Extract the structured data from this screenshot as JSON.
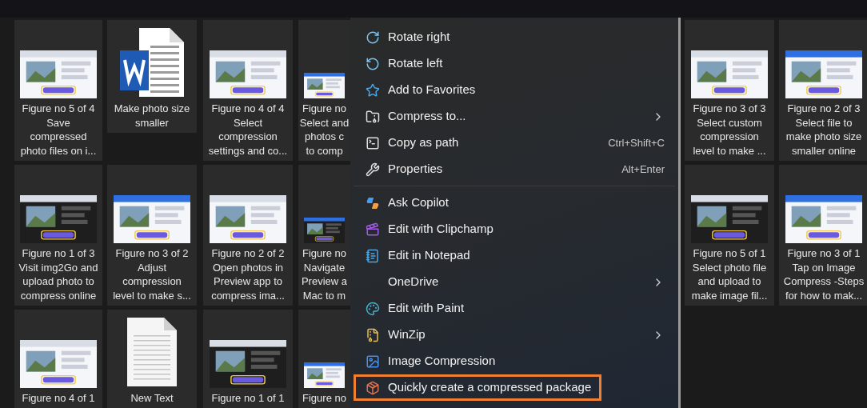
{
  "left_tiles": [
    {
      "kind": "picture",
      "caption": [
        "Figure no 5 of 4",
        "Save",
        "compressed",
        "photo files on i..."
      ]
    },
    {
      "kind": "word",
      "caption": [
        "Make photo size",
        "smaller"
      ]
    },
    {
      "kind": "picture",
      "caption": [
        "Figure no 4 of 4",
        "Select",
        "compression",
        "settings and co..."
      ]
    },
    {
      "kind": "picture",
      "caption": [
        "Figure no",
        "Select and",
        "photos c",
        "to comp"
      ]
    },
    {
      "kind": "picture",
      "caption": [
        "Figure no 1 of 3",
        "Visit img2Go and",
        "upload photo to",
        "compress online"
      ]
    },
    {
      "kind": "picture",
      "caption": [
        "Figure no 3 of 2",
        "Adjust",
        "compression",
        "level to make s..."
      ]
    },
    {
      "kind": "picture",
      "caption": [
        "Figure no 2 of 2",
        "Open photos in",
        "Preview app to",
        "compress ima..."
      ]
    },
    {
      "kind": "picture",
      "caption": [
        "Figure no",
        "Navigate",
        "Preview a",
        "Mac to m"
      ]
    },
    {
      "kind": "picture",
      "caption": [
        "Figure no 4 of 1"
      ]
    },
    {
      "kind": "text",
      "caption": [
        "New Text"
      ]
    },
    {
      "kind": "picture",
      "caption": [
        "Figure no 1 of 1"
      ]
    },
    {
      "kind": "picture",
      "caption": [
        "Figure no"
      ]
    }
  ],
  "context_menu": {
    "sections": [
      [
        {
          "label": "Rotate right",
          "highlighted": false
        },
        {
          "label": "Rotate left",
          "highlighted": false
        },
        {
          "label": "Add to Favorites",
          "highlighted": false
        },
        {
          "label": "Compress to...",
          "submenu": true,
          "highlighted": false
        },
        {
          "label": "Copy as path",
          "shortcut": "Ctrl+Shift+C",
          "highlighted": false
        },
        {
          "label": "Properties",
          "shortcut": "Alt+Enter",
          "highlighted": false
        }
      ],
      [
        {
          "label": "Ask Copilot",
          "highlighted": false
        },
        {
          "label": "Edit with Clipchamp",
          "highlighted": false
        },
        {
          "label": "Edit in Notepad",
          "highlighted": false
        },
        {
          "label": "OneDrive",
          "submenu": true,
          "highlighted": false
        },
        {
          "label": "Edit with Paint",
          "highlighted": false
        },
        {
          "label": "WinZip",
          "submenu": true,
          "highlighted": false
        },
        {
          "label": "Image Compression",
          "highlighted": false
        },
        {
          "label": "Quickly create a compressed package",
          "highlighted": true
        }
      ]
    ]
  },
  "right_tiles": [
    {
      "kind": "picture",
      "caption": [
        "Figure no 3 of 3",
        "Select custom",
        "compression",
        "level to make ..."
      ]
    },
    {
      "kind": "picture",
      "caption": [
        "Figure no 2 of 3",
        "Select file to",
        "make photo size",
        "smaller online"
      ]
    },
    {
      "kind": "picture",
      "caption": [
        "Figure no 5 of 1",
        "Select photo file",
        "and upload to",
        "make image fil..."
      ]
    },
    {
      "kind": "picture",
      "caption": [
        "Figure no 3 of 1",
        "Tap on Image",
        "Compress -Steps",
        "for how to mak..."
      ]
    }
  ]
}
